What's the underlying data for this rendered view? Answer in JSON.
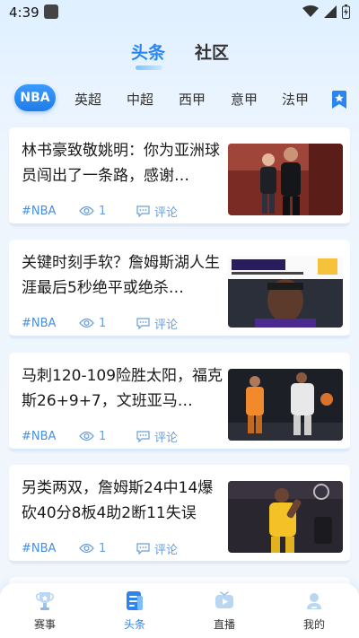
{
  "status": {
    "time": "4:39"
  },
  "top_tabs": [
    {
      "label": "头条",
      "active": true
    },
    {
      "label": "社区",
      "active": false
    }
  ],
  "league_tabs": [
    "NBA",
    "英超",
    "中超",
    "西甲",
    "意甲",
    "法甲"
  ],
  "articles": [
    {
      "title": "林书豪致敬姚明：你为亚洲球员闯出了一条路，感谢…",
      "tag": "#NBA",
      "views": "1",
      "comment_label": "评论",
      "image_icon": "photo-two-players"
    },
    {
      "title": "关键时刻手软？詹姆斯湖人生涯最后5秒绝平或绝杀…",
      "tag": "#NBA",
      "views": "1",
      "comment_label": "评论",
      "image_icon": "photo-lebron-stats"
    },
    {
      "title": "马刺120-109险胜太阳，福克斯26+9+7，文班亚马…",
      "tag": "#NBA",
      "views": "1",
      "comment_label": "评论",
      "image_icon": "photo-spurs-suns"
    },
    {
      "title": "另类两双，詹姆斯24中14爆砍40分8板4助2断11失误",
      "tag": "#NBA",
      "views": "1",
      "comment_label": "评论",
      "image_icon": "photo-lakers-23"
    }
  ],
  "bottom_nav": [
    {
      "label": "赛事",
      "icon": "trophy-icon",
      "active": false
    },
    {
      "label": "头条",
      "icon": "headline-icon",
      "active": true
    },
    {
      "label": "直播",
      "icon": "live-icon",
      "active": false
    },
    {
      "label": "我的",
      "icon": "profile-icon",
      "active": false
    }
  ],
  "colors": {
    "accent": "#2a86ee",
    "meta": "#6a9ed8"
  }
}
